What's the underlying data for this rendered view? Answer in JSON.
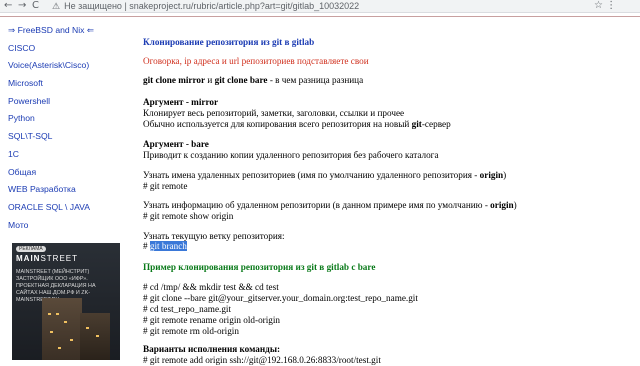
{
  "browser": {
    "back": "←",
    "forward": "→",
    "reload": "C",
    "security": "Не защищено",
    "url": "| snakeproject.ru/rubric/article.php?art=git/gitlab_10032022",
    "right_icons": "☆  ⋮"
  },
  "sidebar": {
    "home": "⇒ FreeBSD and Nix ⇐",
    "items": [
      "CISCO",
      "Voice(Asterisk\\Cisco)",
      "Microsoft",
      "Powershell",
      "Python",
      "SQL\\T-SQL",
      "1C",
      "Общая",
      "WEB Разработка",
      "ORACLE SQL \\ JAVA",
      "Мото"
    ]
  },
  "ad": {
    "badge": "РЕКЛАМА",
    "brand_a": "MAIN",
    "brand_b": "STREET",
    "text": "MAINSTREET (МЕЙНСТРИТ) ЗАСТРОЙЩИК ООО «ИФР». ПРОЕКТНАЯ ДЕКЛАРАЦИЯ НА САЙТАХ НАШ.ДОМ.РФ И ZK-MAINSTREET.RU"
  },
  "article": {
    "title": "Клонирование репозитория из git в gitlab",
    "note": "Оговорка, ip адреса и url репозиториев подставляете свои",
    "diff_a": "git clone mirror",
    "diff_b": " и ",
    "diff_c": "git clone bare",
    "diff_d": " - в чем разница разница",
    "mirror_head": "Аргумент - mirror",
    "mirror_1": "Клонирует весь репозиторий, заметки, заголовки, ссылки и прочее",
    "mirror_2a": "Обычно используется для копирования всего репозитория на новый ",
    "mirror_2b": "git",
    "mirror_2c": "-сервер",
    "bare_head": "Аргумент - bare",
    "bare_1": "Приводит к созданию копии удаленного репозитория без рабочего каталога",
    "remotes_a": "Узнать имена удаленных репозиториев (имя по умолчанию удаленного репозитория - ",
    "remotes_b": "origin",
    "remotes_c": ")",
    "remotes_cmd": "# git remote",
    "info_a": "Узнать информацию об удаленном репозитории (в данном примере имя по умолчанию - ",
    "info_b": "origin",
    "info_c": ")",
    "info_cmd": "# git remote show origin",
    "branch_label": "Узнать текущую ветку репозитория:",
    "branch_hash": "# ",
    "branch_cmd": "git branch",
    "example_title": "Пример клонирования репозитория из git в gitlab с bare",
    "cmds": [
      "# cd /tmp/ && mkdir test && cd test",
      "# git clone --bare git@your_gitserver.your_domain.org:test_repo_name.git",
      "# cd test_repo_name.git",
      "# git remote rename origin old-origin",
      "# git remote rm old-origin"
    ],
    "variants": "Варианты исполнения команды:",
    "last_cmd": "# git remote add origin ssh://git@192.168.0.26:8833/root/test.git"
  }
}
